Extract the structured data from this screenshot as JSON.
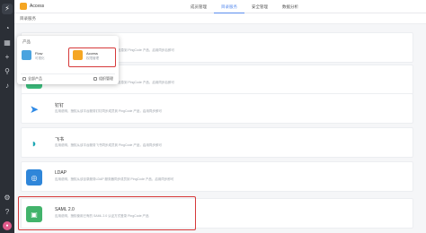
{
  "header": {
    "app_title": "Access",
    "tabs": [
      {
        "label": "成员管理"
      },
      {
        "label": "目录服务"
      },
      {
        "label": "安全管理"
      },
      {
        "label": "数据分析"
      }
    ]
  },
  "subheader": {
    "crumb": "目录服务"
  },
  "services": [
    {
      "name": "",
      "desc": "应用说明，授权从该目录服务同步成员、部门信息到 PingCode 产品，启用同步后即可"
    },
    {
      "name": "",
      "desc": "应用说明，授权从该目录服务同步成员、部门信息到 PingCode 产品，启用同步后即可"
    },
    {
      "name": "钉钉",
      "desc": "应用说明，授权从该平台服务钉钉同步成员到 PingCode 产品，启用同步即可"
    },
    {
      "name": "飞书",
      "desc": "应用说明，授权从该平台服务飞书同步成员到 PingCode 产品，启用同步即可"
    },
    {
      "name": "LDAP",
      "desc": "应用说明，授权从该目录服务LDAP 服务器同步成员到 PingCode 产品，启用同步即可"
    },
    {
      "name": "SAML 2.0",
      "desc": "应用说明，授权使用已有的 SAML 2.0 认证方式登录 PingCode 产品"
    }
  ],
  "dropdown": {
    "title": "产品",
    "products": [
      {
        "name": "Flow",
        "sub": "可视化"
      },
      {
        "name": "Access",
        "sub": "权限管理"
      }
    ],
    "footer_left": "全部产品",
    "footer_right": "组织管理"
  },
  "colors": {
    "accent": "#5a8dee",
    "highlight": "#d6393a",
    "rail": "#2b2f36",
    "access_icon": "#f5a623"
  }
}
